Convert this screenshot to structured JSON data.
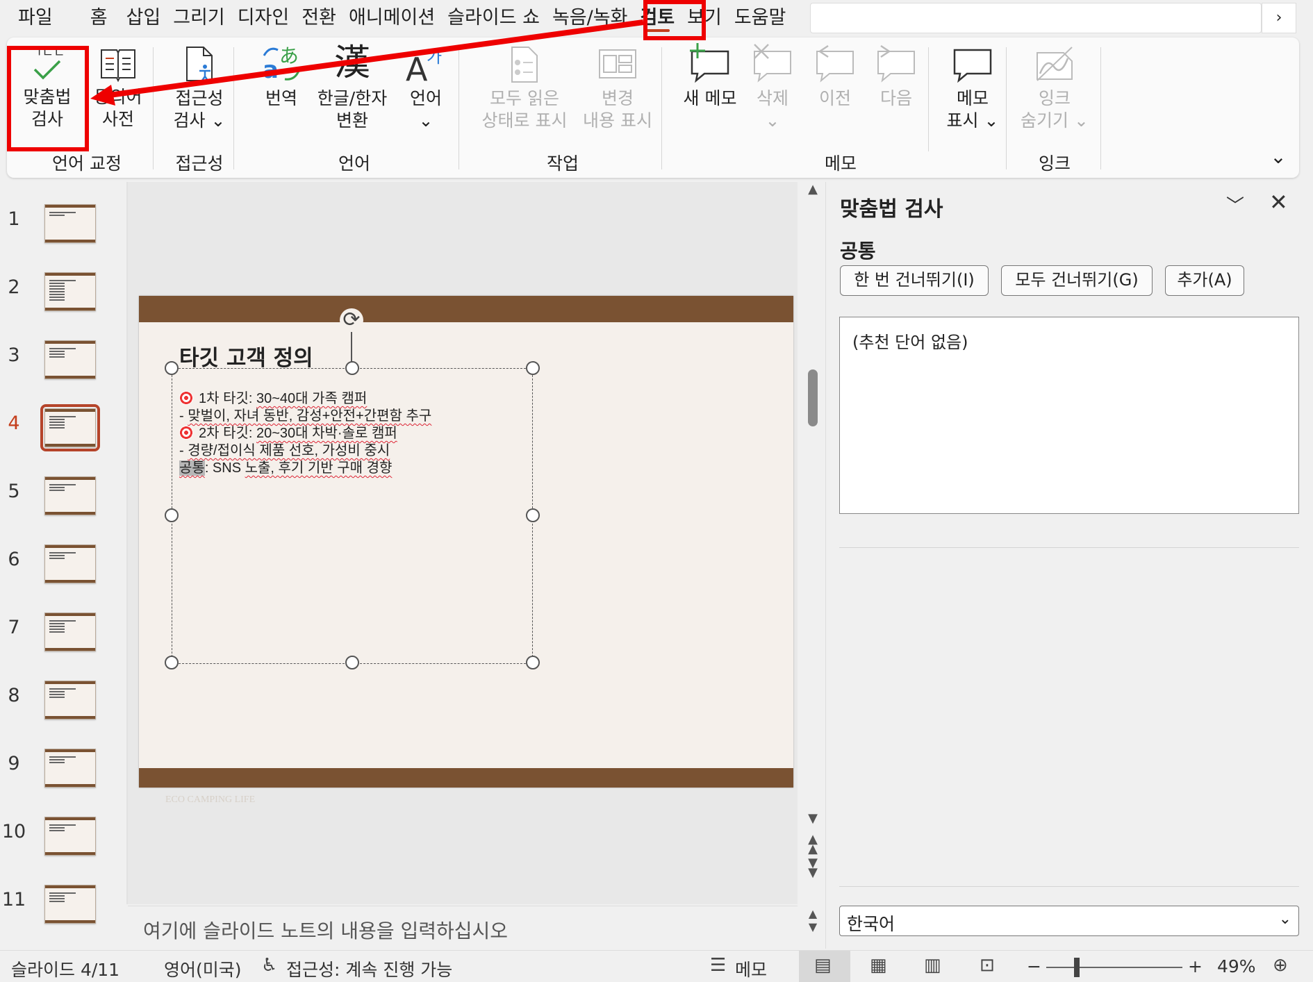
{
  "menu": {
    "tabs": [
      "파일",
      "홈",
      "삽입",
      "그리기",
      "디자인",
      "전환",
      "애니메이션",
      "슬라이드 쇼",
      "녹음/녹화",
      "검토",
      "보기",
      "도움말"
    ],
    "active_tab": "검토",
    "scroll_glyph": "›"
  },
  "ribbon": {
    "spelling": "맞춤법\n검사",
    "thesaurus": "동의어\n사전",
    "accessibility": "접근성\n검사 ⌄",
    "translate": "번역",
    "hanja": "한글/한자\n변환",
    "language": "언어\n⌄",
    "mark_all_read": "모두 읽은\n상태로 표시",
    "show_changes": "변경\n내용 표시",
    "new_comment": "새 메모",
    "delete": "삭제\n⌄",
    "previous": "이전",
    "next": "다음",
    "show_comments": "메모\n표시 ⌄",
    "hide_ink": "잉크\n숨기기 ⌄",
    "groups": {
      "proofing": "언어 교정",
      "accessibility": "접근성",
      "language": "언어",
      "activity": "작업",
      "comments": "메모",
      "ink": "잉크"
    },
    "expand_glyph": "⌄"
  },
  "thumbnails": [
    "1",
    "2",
    "3",
    "4",
    "5",
    "6",
    "7",
    "8",
    "9",
    "10",
    "11"
  ],
  "active_slide": 4,
  "slide": {
    "title": "타깃 고객 정의",
    "lines": [
      {
        "pre": "1차 타깃: ",
        "sq": "30~40대 가족 캠퍼",
        "icon": true
      },
      {
        "pre": "- ",
        "sq": "맞벌이, 자녀 동반, 감성+안전+간편함 추구",
        "icon": false
      },
      {
        "pre": "2차 타깃: ",
        "sq": "20~30대 차박·솔로 캠퍼",
        "icon": true
      },
      {
        "pre": "- ",
        "sq": "경량/접이식 제품 선호, 가성비 중시",
        "icon": false
      },
      {
        "hl": "공통",
        "pre": ": SNS ",
        "sq": "노출, 후기 기반 구매 경향",
        "icon": false
      }
    ],
    "footer": "ECO CAMPING LIFE"
  },
  "notes": {
    "placeholder": "여기에 슬라이드 노트의 내용을 입력하십시오"
  },
  "pane": {
    "title": "맞춤법 검사",
    "word": "공통",
    "ignore_once": "한 번 건너뛰기(I)",
    "ignore_all": "모두 건너뛰기(G)",
    "add": "추가(A)",
    "suggestions": "(추천 단어 없음)",
    "language": "한국어"
  },
  "status": {
    "slide_pos": "슬라이드 4/11",
    "language": "영어(미국)",
    "accessibility": "접근성: 계속 진행 가능",
    "notes": "메모",
    "zoom": "49%",
    "zoom_minus": "−",
    "zoom_plus": "+"
  },
  "colors": {
    "accent": "#c43e1c",
    "slide_bar": "#7a5232",
    "annotation": "#e00000"
  }
}
